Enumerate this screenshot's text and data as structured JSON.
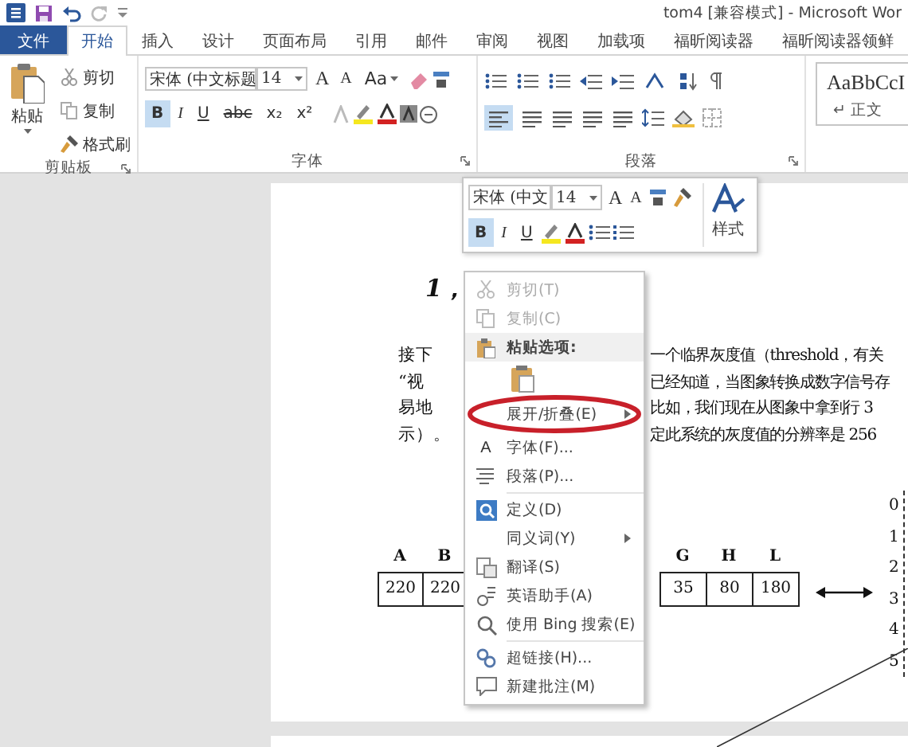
{
  "window": {
    "title": "tom4 [兼容模式] - Microsoft Wor"
  },
  "tabs": [
    {
      "label": "文件",
      "kind": "file",
      "selected": false
    },
    {
      "label": "开始",
      "kind": "tab",
      "selected": true
    },
    {
      "label": "插入",
      "kind": "tab",
      "selected": false
    },
    {
      "label": "设计",
      "kind": "tab",
      "selected": false
    },
    {
      "label": "页面布局",
      "kind": "tab",
      "selected": false
    },
    {
      "label": "引用",
      "kind": "tab",
      "selected": false
    },
    {
      "label": "邮件",
      "kind": "tab",
      "selected": false
    },
    {
      "label": "审阅",
      "kind": "tab",
      "selected": false
    },
    {
      "label": "视图",
      "kind": "tab",
      "selected": false
    },
    {
      "label": "加载项",
      "kind": "tab",
      "selected": false
    },
    {
      "label": "福昕阅读器",
      "kind": "tab",
      "selected": false
    },
    {
      "label": "福昕阅读器领鲜",
      "kind": "tab",
      "selected": false
    }
  ],
  "clipboard": {
    "paste": "粘贴",
    "cut": "剪切",
    "copy": "复制",
    "format_painter": "格式刷",
    "group_label": "剪贴板"
  },
  "font": {
    "name": "宋体 (中文标题",
    "size": "14",
    "grow": "A",
    "shrink": "A",
    "case": "Aa",
    "group_label": "字体",
    "buttons": [
      {
        "label": "B",
        "kind": "bold",
        "selected": true
      },
      {
        "label": "I",
        "kind": "italic",
        "selected": false
      },
      {
        "label": "U",
        "kind": "underline",
        "selected": false
      },
      {
        "label": "abc",
        "kind": "strike",
        "selected": false
      },
      {
        "label": "x₂",
        "kind": "sub",
        "selected": false
      },
      {
        "label": "x²",
        "kind": "sup",
        "selected": false
      }
    ]
  },
  "paragraph": {
    "group_label": "段落",
    "align_left_selected": true
  },
  "styles": {
    "preview": "AaBbCcI",
    "name": "↵ 正文"
  },
  "mini_toolbar": {
    "font": "宋体 (中文",
    "size": "14",
    "grow": "A",
    "shrink": "A",
    "bold": "B",
    "italic": "I",
    "underline": "U",
    "bold_selected": true,
    "styles_label": "样式"
  },
  "document": {
    "heading": "1，",
    "lines": [
      {
        "left": "接下",
        "right": "一个临界灰度值（threshold，有关"
      },
      {
        "left": "“视",
        "right": "已经知道，当图象转换成数字信号存"
      },
      {
        "left": "易地",
        "right": "比如，我们现在从图象中拿到行 3"
      },
      {
        "left": "示）。",
        "right": "定此系统的灰度值的分辨率是 256"
      }
    ],
    "table": {
      "left_labels": [
        "A",
        "B"
      ],
      "left_cells": [
        "220",
        "220"
      ],
      "right_labels": [
        "G",
        "H",
        "L"
      ],
      "right_cells": [
        "35",
        "80",
        "180"
      ],
      "row_numbers": [
        "0",
        "1",
        "2",
        "3",
        "4",
        "5"
      ]
    }
  },
  "context_menu": [
    {
      "kind": "item",
      "label": "剪切(T)",
      "disabled": true,
      "submenu": false,
      "highlighted": false
    },
    {
      "kind": "item",
      "label": "复制(C)",
      "disabled": true,
      "submenu": false,
      "highlighted": false
    },
    {
      "kind": "header",
      "label": "粘贴选项:"
    },
    {
      "kind": "paste"
    },
    {
      "kind": "item",
      "label": "展开/折叠(E)",
      "disabled": false,
      "submenu": true,
      "highlighted": true
    },
    {
      "kind": "item",
      "label": "字体(F)...",
      "icon_glyph": "A",
      "disabled": false,
      "submenu": false,
      "highlighted": false
    },
    {
      "kind": "item",
      "label": "段落(P)...",
      "disabled": false,
      "submenu": false,
      "highlighted": false
    },
    {
      "kind": "separator"
    },
    {
      "kind": "item",
      "label": "定义(D)",
      "disabled": false,
      "submenu": false,
      "highlighted": false
    },
    {
      "kind": "item",
      "label": "同义词(Y)",
      "disabled": false,
      "submenu": true,
      "highlighted": false
    },
    {
      "kind": "item",
      "label": "翻译(S)",
      "disabled": false,
      "submenu": false,
      "highlighted": false
    },
    {
      "kind": "item",
      "label": "英语助手(A)",
      "disabled": false,
      "submenu": false,
      "highlighted": false
    },
    {
      "kind": "item",
      "label": "使用 Bing 搜索(E)",
      "disabled": false,
      "submenu": false,
      "highlighted": false
    },
    {
      "kind": "separator"
    },
    {
      "kind": "item",
      "label": "超链接(H)...",
      "disabled": false,
      "submenu": false,
      "highlighted": false
    },
    {
      "kind": "item",
      "label": "新建批注(M)",
      "disabled": false,
      "submenu": false,
      "highlighted": false
    }
  ]
}
